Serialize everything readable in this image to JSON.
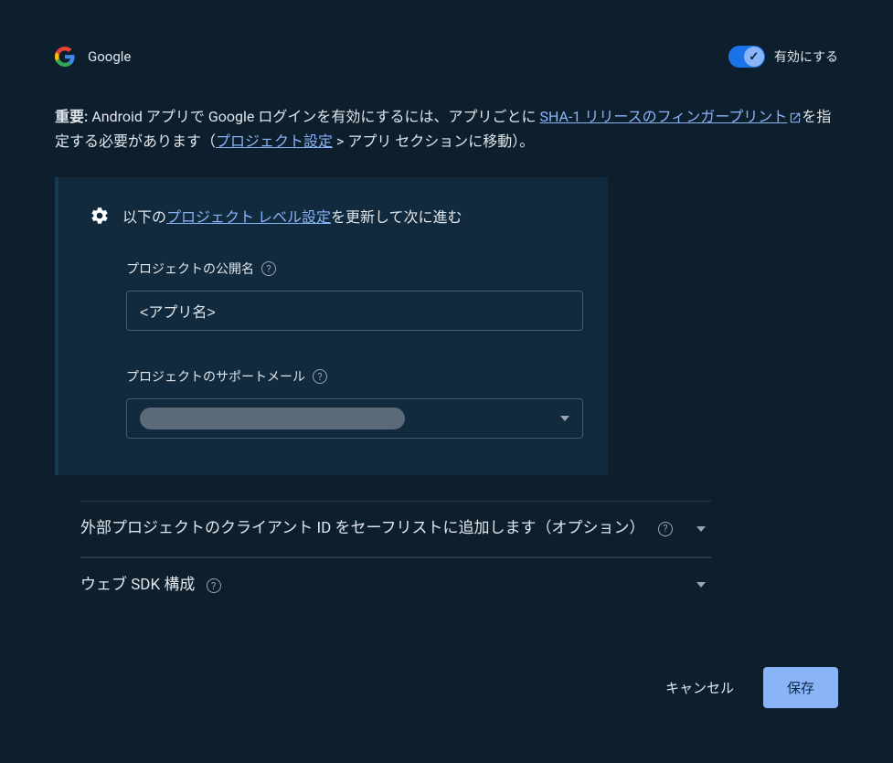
{
  "provider": {
    "name": "Google"
  },
  "toggle": {
    "label": "有効にする",
    "enabled": true
  },
  "info": {
    "prefix_bold": "重要:",
    "text1": " Android アプリで Google ログインを有効にするには、アプリごとに ",
    "link_sha1": "SHA-1 リリースのフィンガープリント",
    "text2": "を指定する必要があります（",
    "link_project_settings": "プロジェクト設定",
    "text3": " > アプリ セクションに移動）。"
  },
  "card": {
    "header_pre": "以下の",
    "header_link": "プロジェクト レベル設定",
    "header_post": "を更新して次に進む",
    "public_name_label": "プロジェクトの公開名",
    "public_name_value": "<アプリ名>",
    "support_email_label": "プロジェクトのサポートメール"
  },
  "accordion": {
    "safelist": "外部プロジェクトのクライアント ID をセーフリストに追加します（オプション）",
    "websdk": "ウェブ SDK 構成"
  },
  "actions": {
    "cancel": "キャンセル",
    "save": "保存"
  }
}
